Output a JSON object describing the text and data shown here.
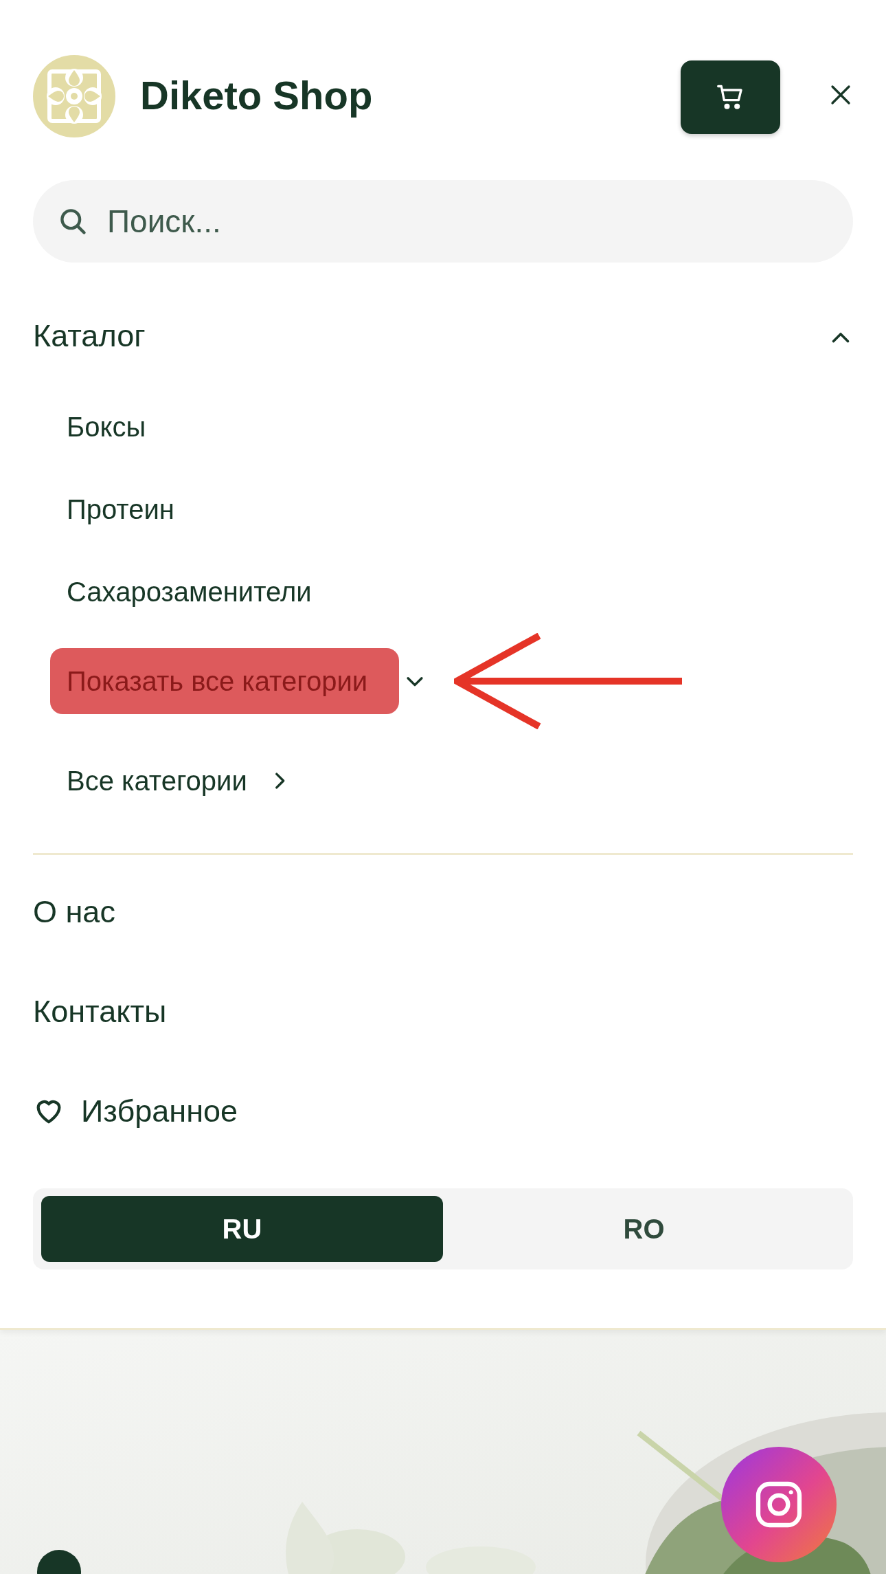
{
  "header": {
    "title": "Diketo Shop"
  },
  "search": {
    "placeholder": "Поиск..."
  },
  "menu": [
    {
      "label": "Каталог",
      "kind": "group",
      "expanded": true,
      "children": [
        {
          "label": "Боксы",
          "kind": "link"
        },
        {
          "label": "Протеин",
          "kind": "link"
        },
        {
          "label": "Сахарозаменители",
          "kind": "link"
        },
        {
          "label": "Показать все категории",
          "kind": "toggle",
          "highlighted": true
        },
        {
          "label": "Все категории",
          "kind": "more"
        }
      ]
    },
    {
      "label": "О нас",
      "kind": "link"
    },
    {
      "label": "Контакты",
      "kind": "link"
    },
    {
      "label": "Избранное",
      "kind": "favorites"
    }
  ],
  "languages": [
    {
      "label": "RU",
      "selected": true
    },
    {
      "label": "RO",
      "selected": false
    }
  ]
}
